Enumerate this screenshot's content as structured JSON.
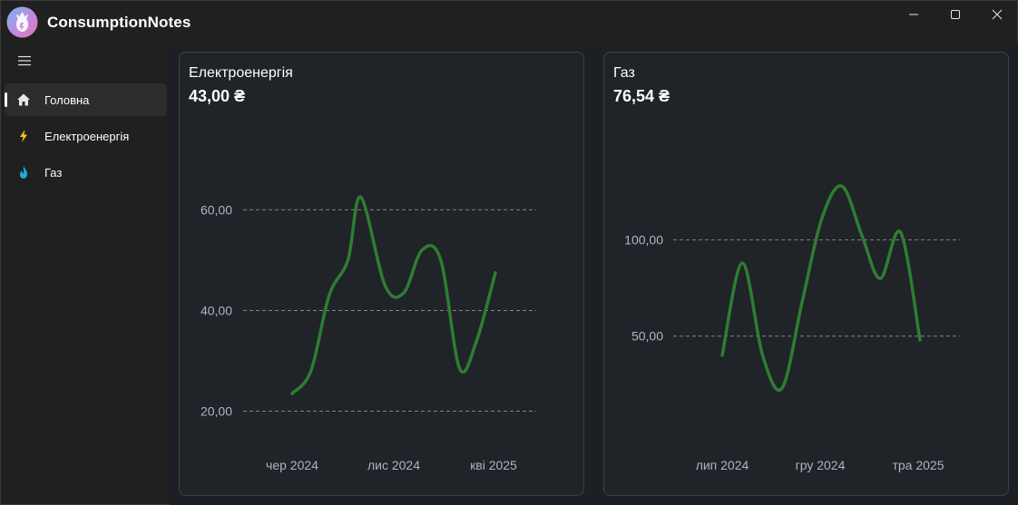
{
  "app": {
    "title": "ConsumptionNotes"
  },
  "window_controls": [
    "minimize-icon",
    "maximize-icon",
    "close-icon"
  ],
  "sidebar": {
    "menu_icon": "hamburger-icon",
    "items": [
      {
        "label": "Головна",
        "icon": "home-icon",
        "active": true,
        "icon_color": "#e8e8e8"
      },
      {
        "label": "Електроенергія",
        "icon": "lightning-icon",
        "active": false,
        "icon_color": "#f5c518"
      },
      {
        "label": "Газ",
        "icon": "flame-icon",
        "active": false,
        "icon_color": "#1ea7e1"
      }
    ]
  },
  "cards": [
    {
      "title": "Електроенергія",
      "value": "43,00 ₴"
    },
    {
      "title": "Газ",
      "value": "76,54 ₴"
    }
  ],
  "colors": {
    "line": "#2e7d32",
    "grid": "#7d8590",
    "tick": "#a9b6c7",
    "card_bg": "#202327",
    "content_bg": "#1c1f24"
  },
  "chart_data": [
    {
      "type": "line",
      "title": "",
      "xlabel": "",
      "ylabel": "",
      "x_ticks": [
        "чер 2024",
        "лис 2024",
        "кві 2025"
      ],
      "y_ticks": [
        "20,00",
        "40,00",
        "60,00"
      ],
      "y_tick_values": [
        20,
        40,
        60
      ],
      "ylim": [
        12,
        75
      ],
      "grid": true,
      "series": [
        {
          "x": [
            "2024-05-20",
            "2024-06-20",
            "2024-07-20",
            "2024-08-20",
            "2024-09-10",
            "2024-10-20",
            "2024-11-20",
            "2024-12-20",
            "2025-01-20",
            "2025-02-20",
            "2025-03-20",
            "2025-04-20"
          ],
          "values": [
            23.5,
            28,
            43,
            50,
            62.5,
            45,
            43.5,
            52,
            50,
            28.5,
            34,
            47.5
          ]
        }
      ]
    },
    {
      "type": "line",
      "title": "",
      "xlabel": "",
      "ylabel": "",
      "x_ticks": [
        "лип 2024",
        "гру 2024",
        "тра 2025"
      ],
      "y_ticks": [
        "50,00",
        "100,00"
      ],
      "y_tick_values": [
        50,
        100
      ],
      "ylim": [
        -10,
        155
      ],
      "grid": true,
      "series": [
        {
          "x": [
            "2024-07-01",
            "2024-08-01",
            "2024-09-01",
            "2024-10-01",
            "2024-11-01",
            "2024-12-01",
            "2025-01-01",
            "2025-02-01",
            "2025-03-01",
            "2025-04-01",
            "2025-05-01"
          ],
          "values": [
            40,
            88,
            40,
            23,
            68,
            111,
            128,
            102,
            80,
            104,
            48
          ]
        }
      ]
    }
  ]
}
